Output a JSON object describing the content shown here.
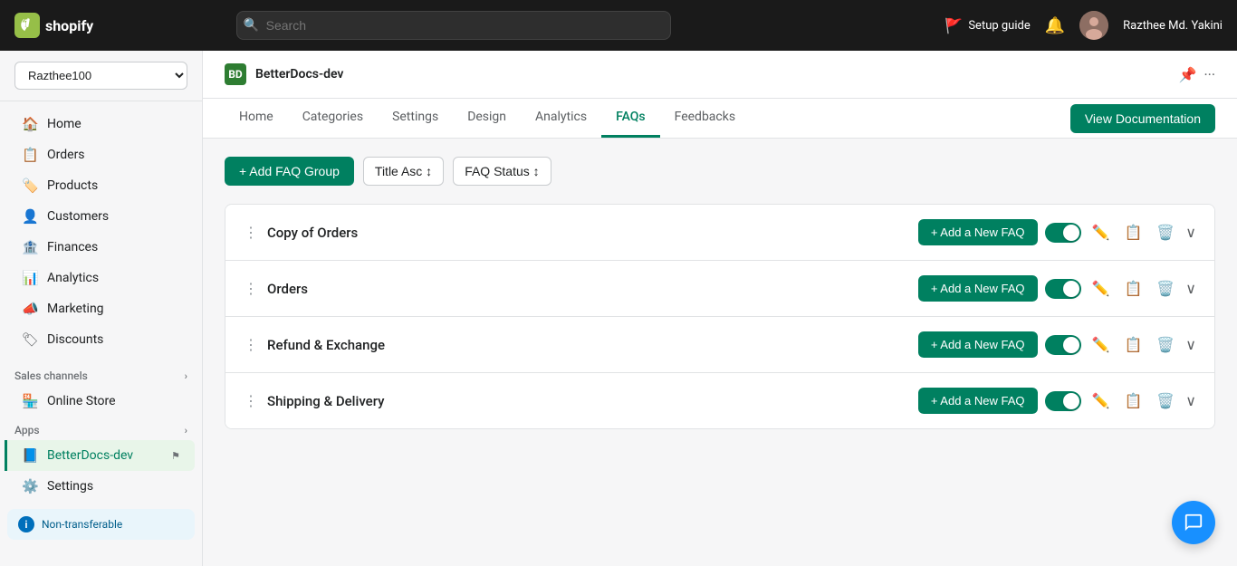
{
  "topNav": {
    "logoText": "shopify",
    "searchPlaceholder": "Search",
    "setupGuideLabel": "Setup guide",
    "bellTitle": "Notifications",
    "userName": "Razthee Md. Yakini"
  },
  "sidebar": {
    "storeSelector": "Razthee100",
    "navItems": [
      {
        "id": "home",
        "label": "Home",
        "icon": "🏠"
      },
      {
        "id": "orders",
        "label": "Orders",
        "icon": "📋"
      },
      {
        "id": "products",
        "label": "Products",
        "icon": "🏷️"
      },
      {
        "id": "customers",
        "label": "Customers",
        "icon": "👤"
      },
      {
        "id": "finances",
        "label": "Finances",
        "icon": "🏦"
      },
      {
        "id": "analytics",
        "label": "Analytics",
        "icon": "📊"
      },
      {
        "id": "marketing",
        "label": "Marketing",
        "icon": "📣"
      },
      {
        "id": "discounts",
        "label": "Discounts",
        "icon": "🏷"
      }
    ],
    "salesChannelsLabel": "Sales channels",
    "salesChannels": [
      {
        "id": "online-store",
        "label": "Online Store",
        "icon": "🏪"
      }
    ],
    "appsLabel": "Apps",
    "apps": [
      {
        "id": "betterdocs-dev",
        "label": "BetterDocs-dev",
        "icon": "📘",
        "active": true
      }
    ],
    "settingsLabel": "Settings",
    "nonTransferableLabel": "Non-transferable"
  },
  "plugin": {
    "iconText": "BD",
    "name": "BetterDocs-dev"
  },
  "tabs": [
    {
      "id": "home",
      "label": "Home",
      "active": false
    },
    {
      "id": "categories",
      "label": "Categories",
      "active": false
    },
    {
      "id": "settings",
      "label": "Settings",
      "active": false
    },
    {
      "id": "design",
      "label": "Design",
      "active": false
    },
    {
      "id": "analytics",
      "label": "Analytics",
      "active": false
    },
    {
      "id": "faqs",
      "label": "FAQs",
      "active": true
    },
    {
      "id": "feedbacks",
      "label": "Feedbacks",
      "active": false
    }
  ],
  "viewDocBtn": "View Documentation",
  "toolbar": {
    "addFaqGroupLabel": "+ Add FAQ Group",
    "titleSortLabel": "Title Asc ↕",
    "faqStatusLabel": "FAQ Status ↕"
  },
  "faqGroups": [
    {
      "id": 1,
      "name": "Copy of Orders",
      "enabled": true
    },
    {
      "id": 2,
      "name": "Orders",
      "enabled": true
    },
    {
      "id": 3,
      "name": "Refund & Exchange",
      "enabled": true
    },
    {
      "id": 4,
      "name": "Shipping & Delivery",
      "enabled": true
    }
  ],
  "addNewFaqLabel": "+ Add a New FAQ",
  "colors": {
    "primary": "#008060",
    "primaryHover": "#006e52"
  }
}
